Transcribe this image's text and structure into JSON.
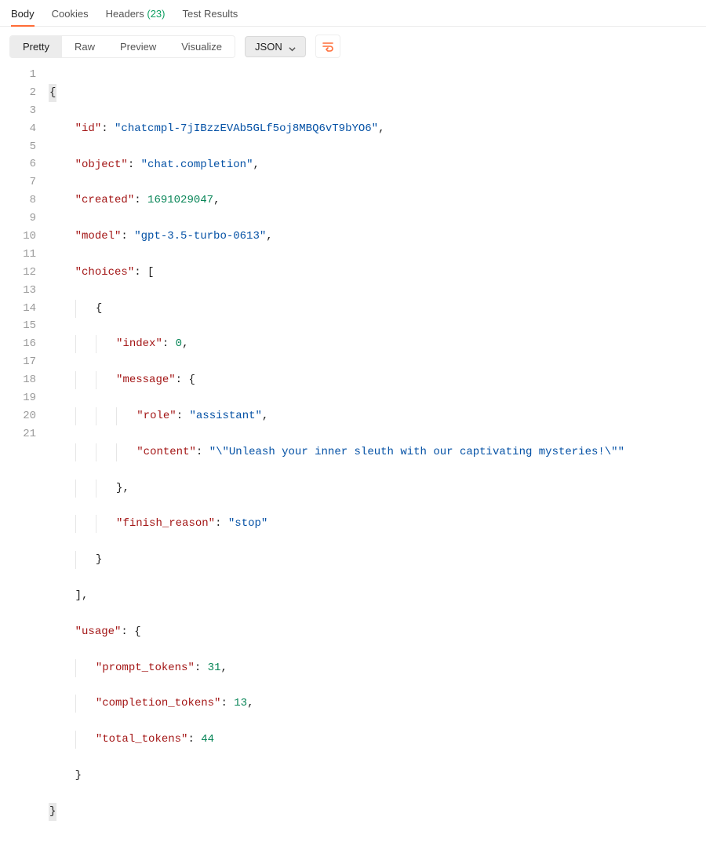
{
  "tabs": {
    "body": "Body",
    "cookies": "Cookies",
    "headers": "Headers",
    "headers_count": "(23)",
    "test_results": "Test Results"
  },
  "viewmodes": {
    "pretty": "Pretty",
    "raw": "Raw",
    "preview": "Preview",
    "visualize": "Visualize"
  },
  "format_dropdown": "JSON",
  "line_count": 21,
  "json_tokens": {
    "id_key": "\"id\"",
    "id_val": "\"chatcmpl-7jIBzzEVAb5GLf5oj8MBQ6vT9bYO6\"",
    "object_key": "\"object\"",
    "object_val": "\"chat.completion\"",
    "created_key": "\"created\"",
    "created_val": "1691029047",
    "model_key": "\"model\"",
    "model_val": "\"gpt-3.5-turbo-0613\"",
    "choices_key": "\"choices\"",
    "index_key": "\"index\"",
    "index_val": "0",
    "message_key": "\"message\"",
    "role_key": "\"role\"",
    "role_val": "\"assistant\"",
    "content_key": "\"content\"",
    "content_val": "\"\\\"Unleash your inner sleuth with our captivating mysteries!\\\"\"",
    "finish_key": "\"finish_reason\"",
    "finish_val": "\"stop\"",
    "usage_key": "\"usage\"",
    "pt_key": "\"prompt_tokens\"",
    "pt_val": "31",
    "ct_key": "\"completion_tokens\"",
    "ct_val": "13",
    "tt_key": "\"total_tokens\"",
    "tt_val": "44"
  }
}
